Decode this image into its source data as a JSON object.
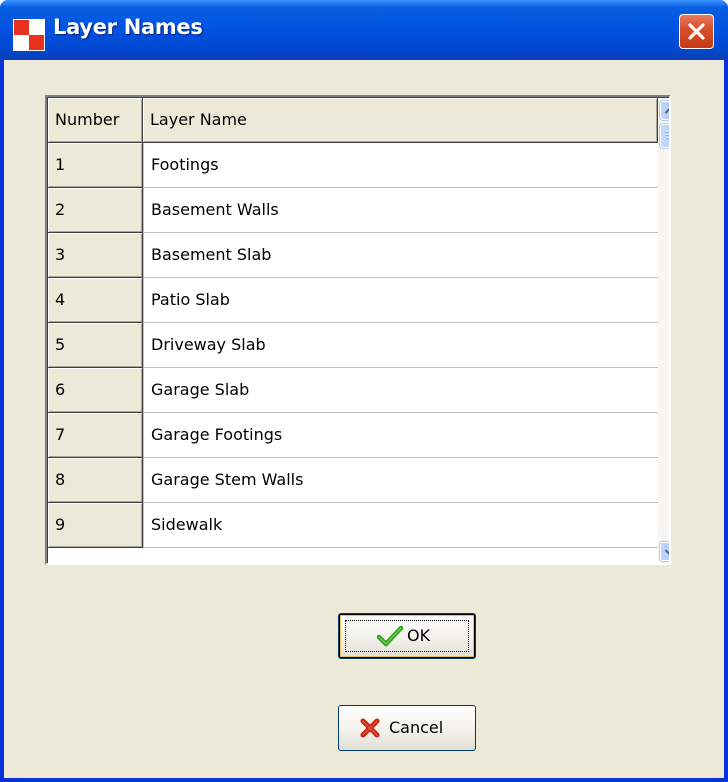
{
  "window": {
    "title": "Layer Names",
    "icon": "app-icon",
    "close_icon": "close-icon"
  },
  "grid": {
    "columns": [
      "Number",
      "Layer Name"
    ],
    "rows": [
      {
        "number": "1",
        "name": "Footings"
      },
      {
        "number": "2",
        "name": "Basement Walls"
      },
      {
        "number": "3",
        "name": "Basement Slab"
      },
      {
        "number": "4",
        "name": "Patio Slab"
      },
      {
        "number": "5",
        "name": "Driveway Slab"
      },
      {
        "number": "6",
        "name": "Garage Slab"
      },
      {
        "number": "7",
        "name": "Garage Footings"
      },
      {
        "number": "8",
        "name": "Garage Stem Walls"
      },
      {
        "number": "9",
        "name": "Sidewalk"
      }
    ],
    "scroll_up_icon": "chevron-up-icon",
    "scroll_down_icon": "chevron-down-icon"
  },
  "buttons": {
    "ok_label": "OK",
    "ok_icon": "checkmark-icon",
    "cancel_label": "Cancel",
    "cancel_icon": "x-icon"
  },
  "colors": {
    "titlebar": "#0054e3",
    "dialog_face": "#ece9d8",
    "ok_icon": "#2e9e1a",
    "cancel_icon": "#c4220f"
  }
}
